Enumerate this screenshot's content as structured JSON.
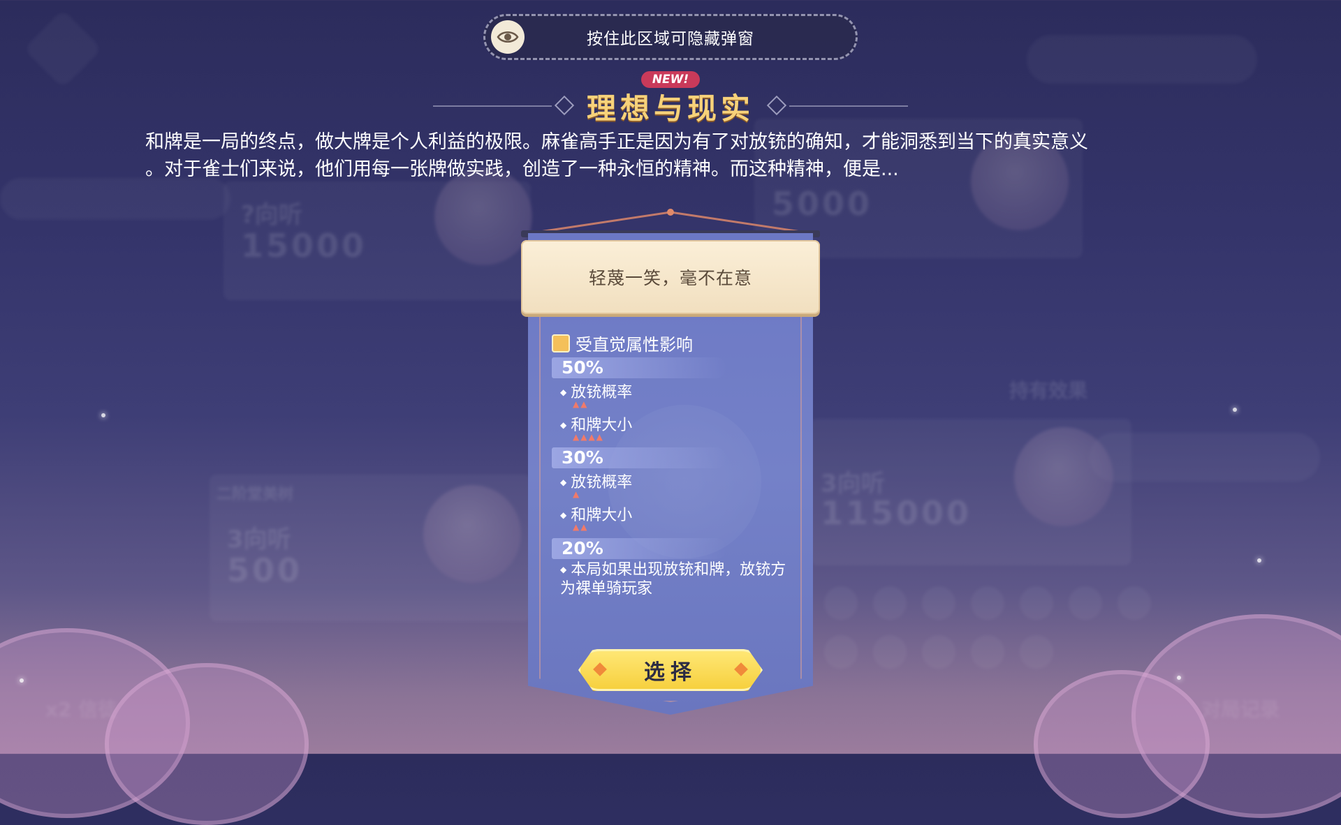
{
  "hide_bar": {
    "label": "按住此区域可隐藏弹窗",
    "icon": "eye-icon"
  },
  "header": {
    "badge": "NEW!",
    "title": "理想与现实"
  },
  "description": {
    "line1": "和牌是一局的终点，做大牌是个人利益的极限。麻雀高手正是因为有了对放铳的确知，才能洞悉到当下的真实意义",
    "line2": "。对于雀士们来说，他们用每一张牌做实践，创造了一种永恒的精神。而这种精神，便是..."
  },
  "card": {
    "option_title": "轻蔑一笑，毫不在意",
    "attribute_label": "受直觉属性影响",
    "tiers": [
      {
        "percent": "50%",
        "effects": [
          {
            "label": "放铳概率",
            "arrows": 2
          },
          {
            "label": "和牌大小",
            "arrows": 4
          }
        ]
      },
      {
        "percent": "30%",
        "effects": [
          {
            "label": "放铳概率",
            "arrows": 1
          },
          {
            "label": "和牌大小",
            "arrows": 2
          }
        ]
      },
      {
        "percent": "20%",
        "effects": [
          {
            "label": "本局如果出现放铳和牌，放铳方为裸单骑玩家"
          }
        ]
      }
    ],
    "select_label": "选择"
  },
  "background": {
    "left_card": {
      "status": "?向听",
      "score": "15000",
      "tiles": [
        "15",
        "15",
        "15",
        "15"
      ]
    },
    "left_lower_card": {
      "name": "二阶堂美树",
      "status": "3向听",
      "score": "500",
      "tiles": [
        "60",
        "60",
        "60",
        "60",
        "60"
      ]
    },
    "right_card": {
      "score": "5000",
      "tiles": [
        "5",
        "5",
        "5",
        "5"
      ]
    },
    "right_lower_card": {
      "status": "3向听",
      "score": "115000",
      "tiles": [
        "90",
        "100",
        "100",
        "100",
        "100"
      ]
    },
    "effects_dropdown": "持有效果",
    "bottom_left": "x2 信徒",
    "bottom_right": "对局记录"
  },
  "colors": {
    "title": "#f7d27a",
    "badge": "#c93a5a",
    "banner": "#7481c8",
    "button": "#f6cf3c",
    "arrow": "#f07a6a"
  }
}
